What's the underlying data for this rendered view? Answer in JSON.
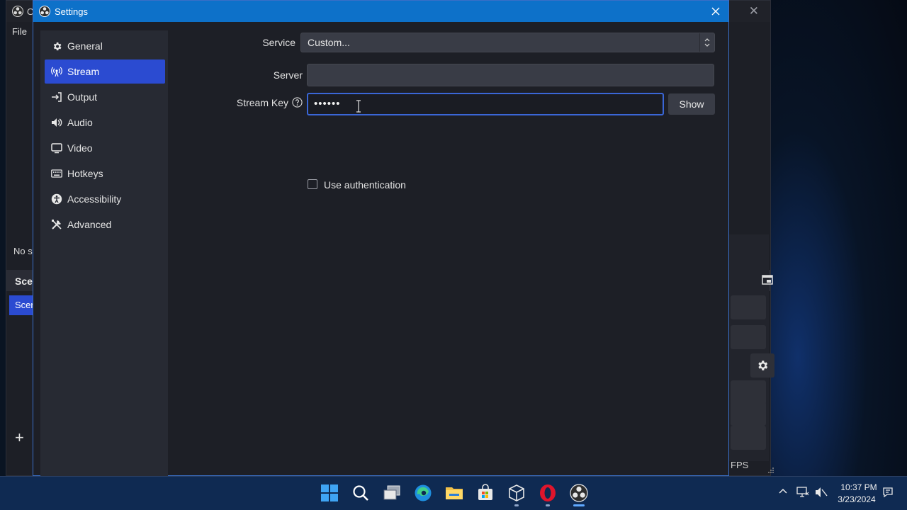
{
  "main_window": {
    "title": "O",
    "menu_file": "File",
    "no_source_text": "No s",
    "scenes_dock_title": "Scen",
    "selected_scene": "Scen",
    "add_symbol": "+",
    "fps_text": "FPS"
  },
  "dialog": {
    "title": "Settings"
  },
  "sidebar": {
    "items": [
      {
        "label": "General",
        "icon": "gear-icon"
      },
      {
        "label": "Stream",
        "icon": "antenna-icon"
      },
      {
        "label": "Output",
        "icon": "output-icon"
      },
      {
        "label": "Audio",
        "icon": "speaker-icon"
      },
      {
        "label": "Video",
        "icon": "monitor-icon"
      },
      {
        "label": "Hotkeys",
        "icon": "keyboard-icon"
      },
      {
        "label": "Accessibility",
        "icon": "accessibility-icon"
      },
      {
        "label": "Advanced",
        "icon": "tools-icon"
      }
    ],
    "selected": "Stream"
  },
  "stream": {
    "service_label": "Service",
    "service_value": "Custom...",
    "server_label": "Server",
    "server_value": "",
    "stream_key_label": "Stream Key",
    "stream_key_value": "••••••",
    "show_button": "Show",
    "use_auth_label": "Use authentication",
    "use_auth_checked": false
  },
  "taskbar": {
    "apps": [
      "windows-start-icon",
      "search-icon",
      "task-view-icon",
      "edge-icon",
      "file-explorer-icon",
      "store-icon",
      "virtualbox-icon",
      "opera-icon",
      "obs-icon"
    ],
    "time": "10:37 PM",
    "date": "3/23/2024"
  },
  "colors": {
    "accent": "#2b4bd1",
    "titlebar": "#0d71c9",
    "background": "#1d1f26",
    "taskbar": "#0f2a52"
  }
}
